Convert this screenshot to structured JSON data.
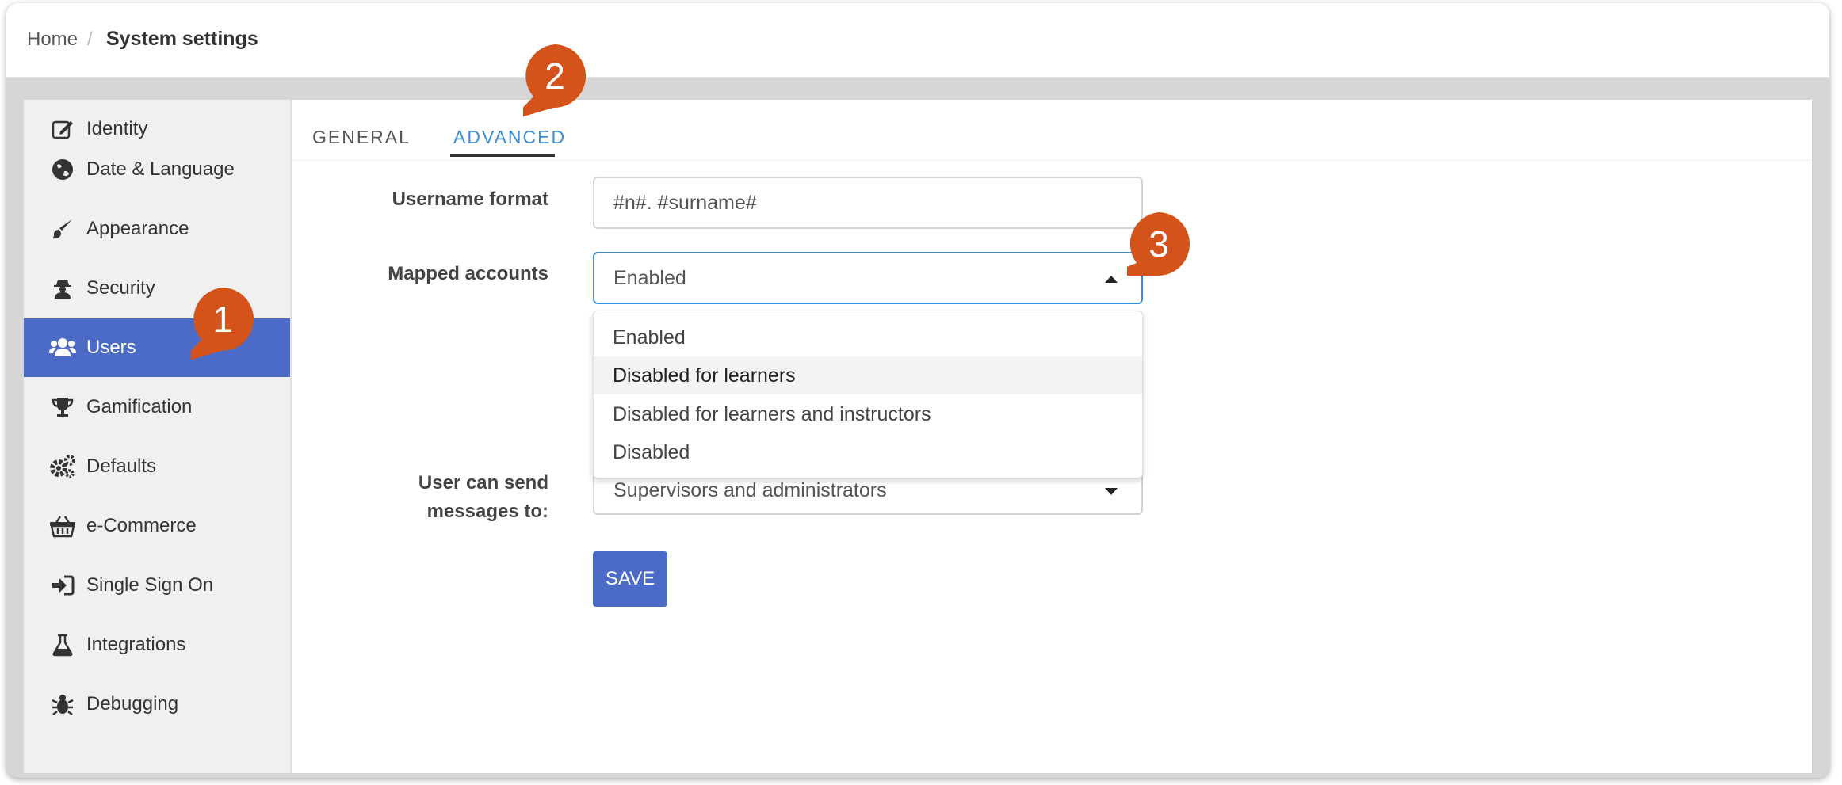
{
  "breadcrumb": {
    "home": "Home",
    "separator": "/",
    "current": "System settings"
  },
  "sidebar": {
    "items": [
      {
        "label": "Identity",
        "icon": "edit-icon"
      },
      {
        "label": "Date & Language",
        "icon": "globe-icon"
      },
      {
        "label": "Appearance",
        "icon": "brush-icon"
      },
      {
        "label": "Security",
        "icon": "user-secret-icon"
      },
      {
        "label": "Users",
        "icon": "users-icon",
        "active": true
      },
      {
        "label": "Gamification",
        "icon": "trophy-icon"
      },
      {
        "label": "Defaults",
        "icon": "gears-icon"
      },
      {
        "label": "e-Commerce",
        "icon": "basket-icon"
      },
      {
        "label": "Single Sign On",
        "icon": "sign-in-icon"
      },
      {
        "label": "Integrations",
        "icon": "flask-icon"
      },
      {
        "label": "Debugging",
        "icon": "bug-icon"
      }
    ]
  },
  "tabs": {
    "general": "GENERAL",
    "advanced": "ADVANCED",
    "active": "ADVANCED"
  },
  "form": {
    "username_format": {
      "label": "Username format",
      "value": "#n#. #surname#"
    },
    "mapped_accounts": {
      "label": "Mapped accounts",
      "value": "Enabled",
      "options": [
        "Enabled",
        "Disabled for learners",
        "Disabled for learners and instructors",
        "Disabled"
      ],
      "highlighted": "Disabled for learners"
    },
    "send_messages": {
      "label_line1": "User can send",
      "label_line2": "messages to:",
      "value": "Supervisors and administrators"
    },
    "save_label": "SAVE"
  },
  "callouts": [
    "1",
    "2",
    "3"
  ],
  "colors": {
    "accent": "#4b6bc7",
    "tab_active": "#3d8fd1",
    "callout": "#d4531a"
  }
}
